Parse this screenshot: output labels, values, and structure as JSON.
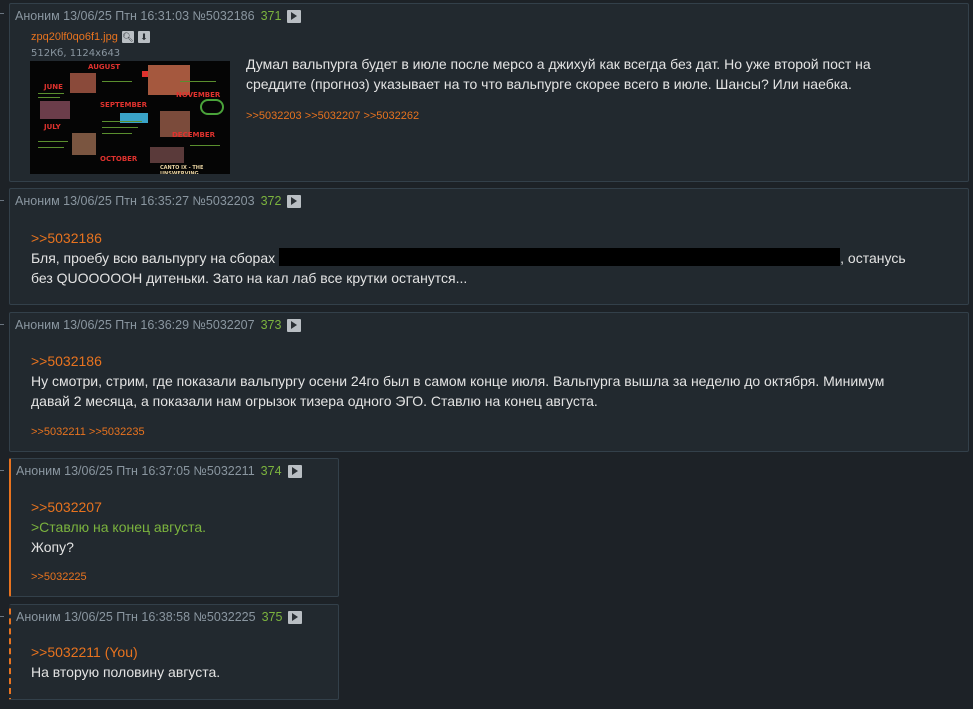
{
  "posts": [
    {
      "author": "Аноним",
      "datetime": "13/06/25 Птн 16:31:03",
      "number": "№5032186",
      "count": "371",
      "file": {
        "name": "zpq20lf0qo6f1.jpg",
        "meta": "512Кб, 1124x643",
        "thumb_labels": [
          "AUGUST",
          "SEPTEMBER",
          "NOVEMBER",
          "DECEMBER",
          "OCTOBER",
          "JUNE",
          "JULY",
          "CANTO IX - THE UNSWERVING"
        ]
      },
      "body_lines": [
        "Думал вальпурга будет в июле после мерсо а джихуй как всегда без дат. Но уже второй пост на",
        "среддите (прогноз) указывает на то что вальпурге скорее всего в июле. Шансы? Или наебка."
      ],
      "replies": ">>5032203 >>5032207 >>5032262"
    },
    {
      "author": "Аноним",
      "datetime": "13/06/25 Птн 16:35:27",
      "number": "№5032203",
      "count": "372",
      "quote": ">>5032186",
      "line1_before": "Бля, проебу всю вальпургу на сборах",
      "line1_after": ", останусь",
      "line2": "без QUOOOOOH дитеньки. Зато на кал лаб все крутки останутся..."
    },
    {
      "author": "Аноним",
      "datetime": "13/06/25 Птн 16:36:29",
      "number": "№5032207",
      "count": "373",
      "quote": ">>5032186",
      "body_lines": [
        "Ну смотри, стрим, где показали вальпургу осени 24го был в самом конце июля. Вальпурга вышла за неделю до октября. Минимум",
        "давай 2 месяца, а показали нам огрызок тизера одного ЭГО. Ставлю на конец августа."
      ],
      "replies": ">>5032211 >>5032235"
    },
    {
      "author": "Аноним",
      "datetime": "13/06/25 Птн 16:37:05",
      "number": "№5032211",
      "count": "374",
      "quote": ">>5032207",
      "greentext": ">Ставлю на конец августа.",
      "body": "Жопу?",
      "replies": ">>5032225"
    },
    {
      "author": "Аноним",
      "datetime": "13/06/25 Птн 16:38:58",
      "number": "№5032225",
      "count": "375",
      "quote": ">>5032211 (You)",
      "body": "На вторую половину августа."
    }
  ],
  "colors": {
    "background": "#1d2227",
    "post_bg": "#22292f",
    "link": "#e8731f",
    "greentext": "#7bb33e",
    "count": "#7bb33e"
  }
}
